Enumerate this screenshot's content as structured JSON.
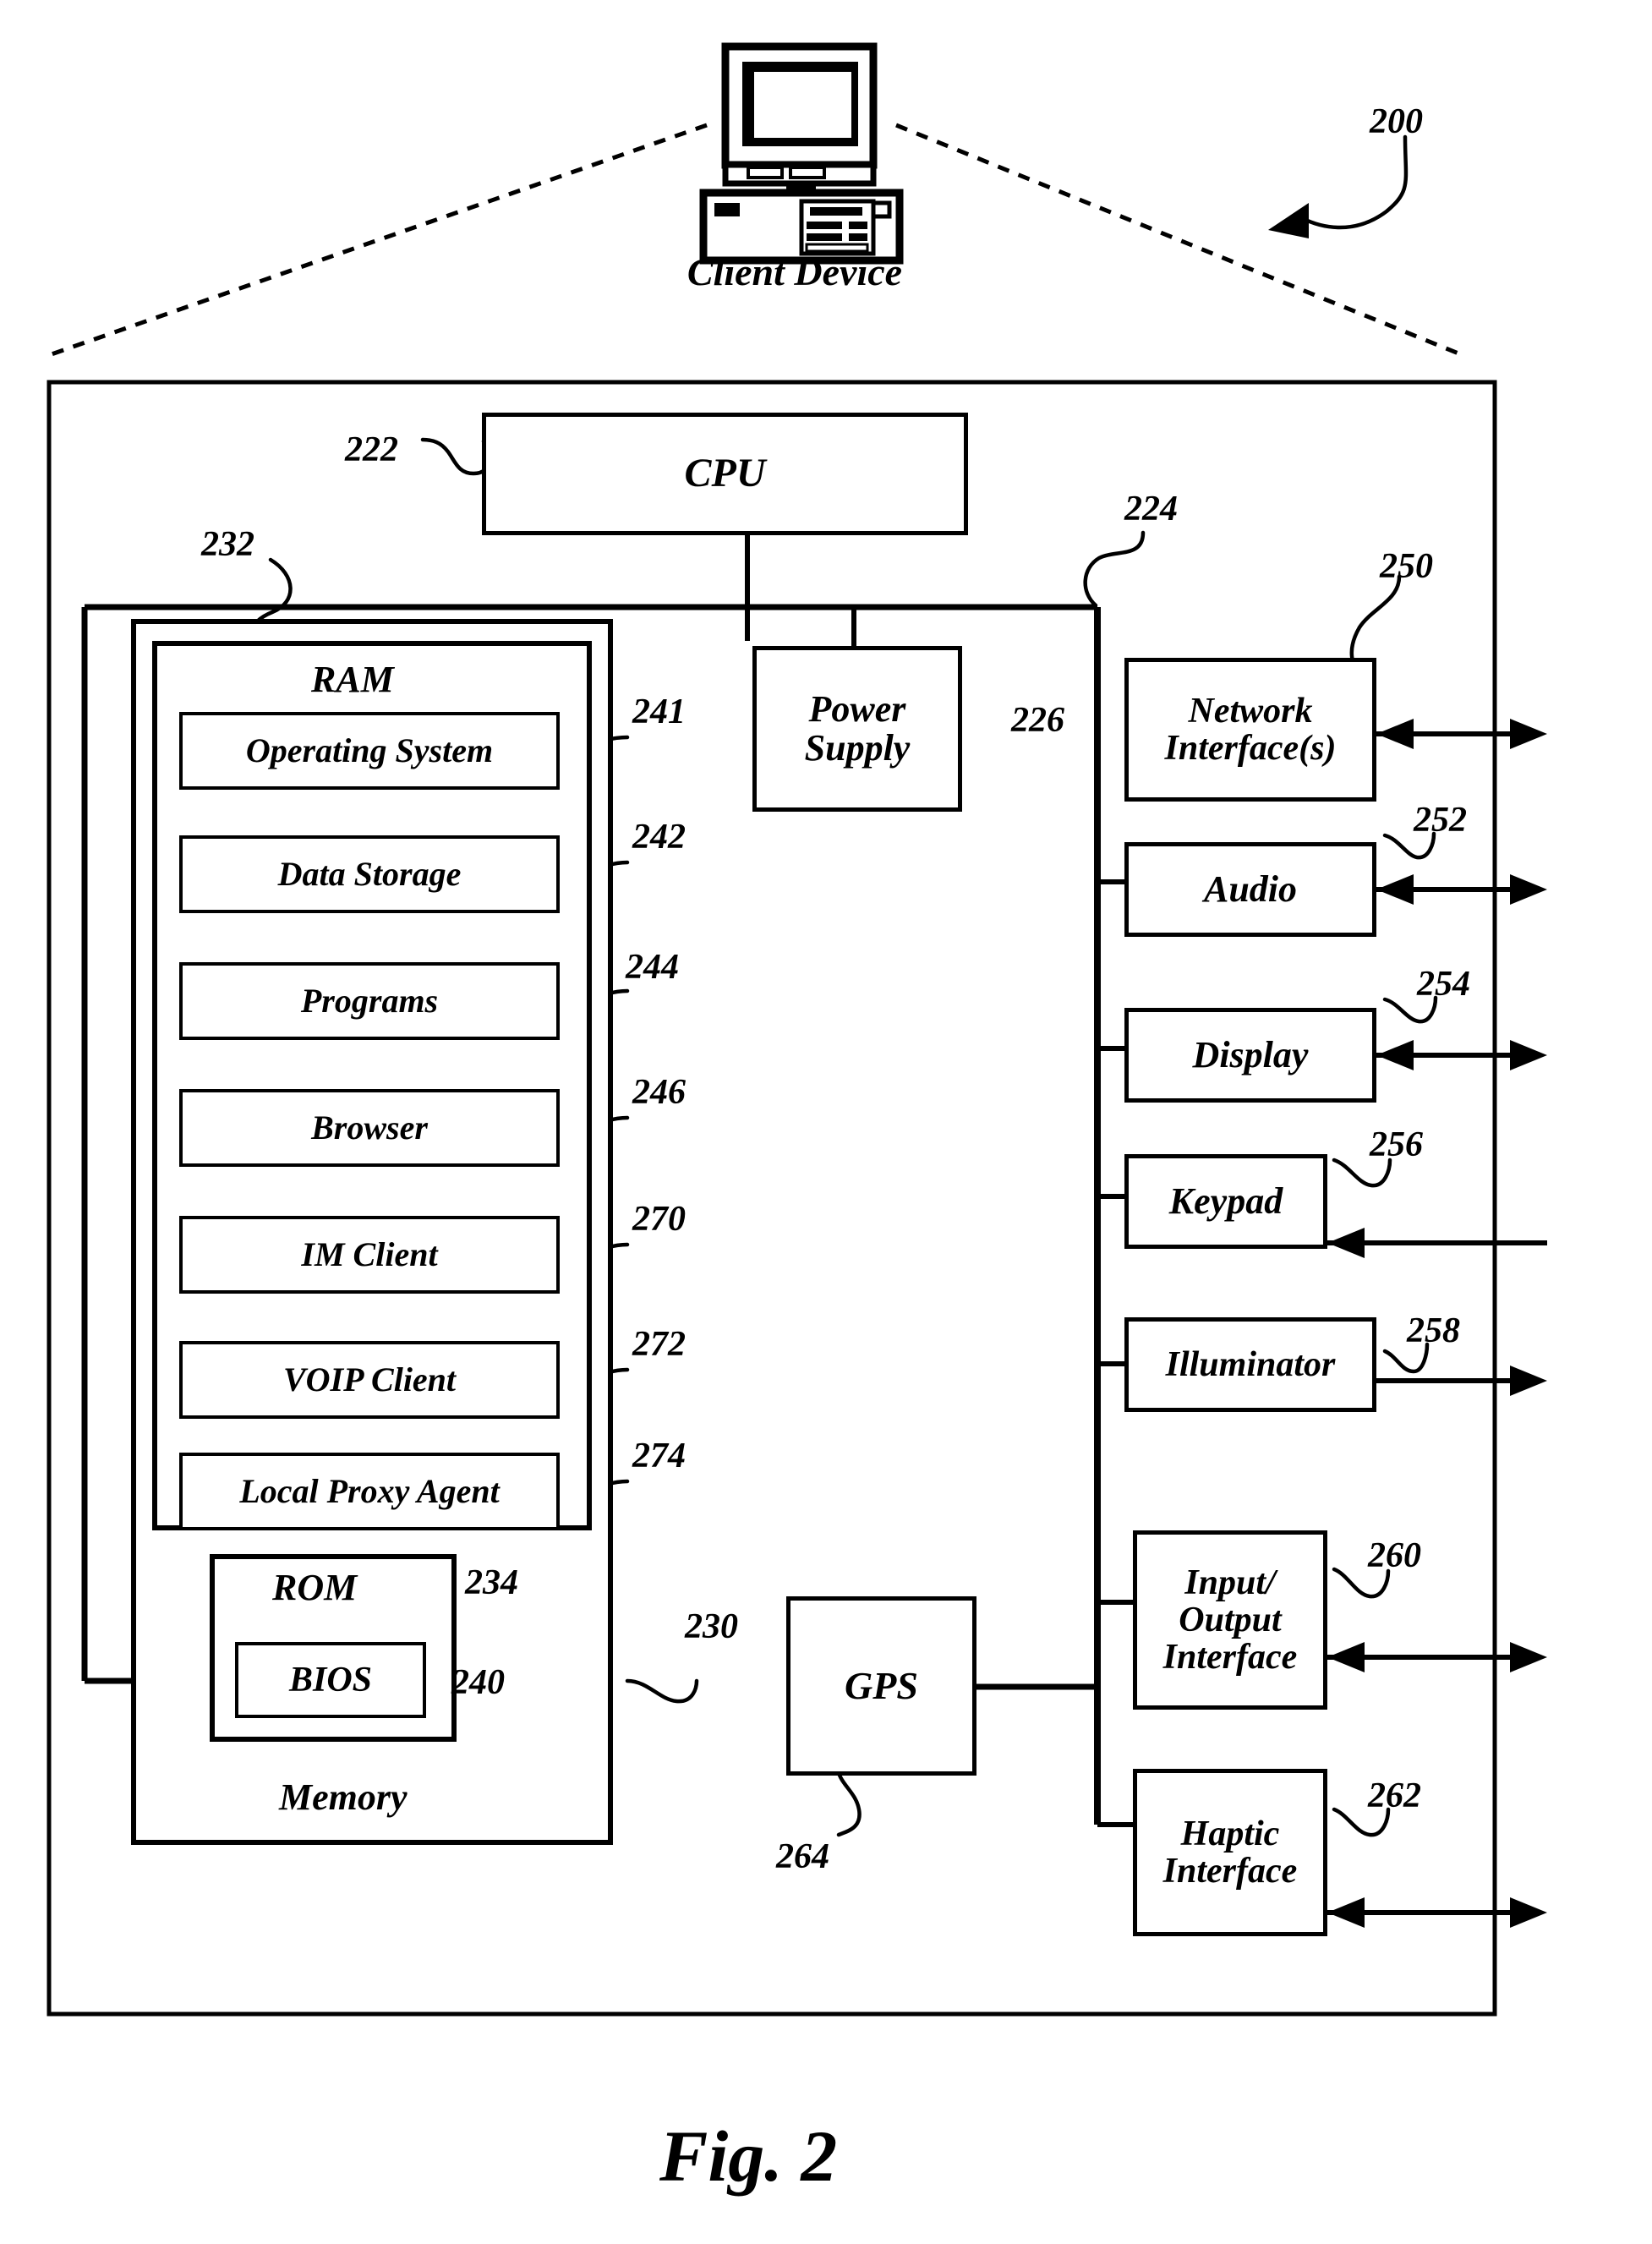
{
  "figure": {
    "caption": "Fig. 2",
    "system_ref": "200",
    "device_label": "Client Device",
    "device_icon": "desktop-computer-icon"
  },
  "blocks": {
    "cpu": {
      "label": "CPU",
      "ref": "222"
    },
    "bus": {
      "ref": "232"
    },
    "memory": {
      "label": "Memory",
      "ref": "230"
    },
    "ram": {
      "label": "RAM"
    },
    "rom": {
      "label": "ROM",
      "ref": "234"
    },
    "bios": {
      "label": "BIOS",
      "ref": "240"
    },
    "power_supply": {
      "label": "Power\nSupply",
      "ref": "226"
    },
    "gps": {
      "label": "GPS",
      "ref": "264"
    },
    "io_bus": {
      "ref": "224"
    }
  },
  "ram_modules": [
    {
      "label": "Operating System",
      "ref": "241"
    },
    {
      "label": "Data Storage",
      "ref": "242"
    },
    {
      "label": "Programs",
      "ref": "244"
    },
    {
      "label": "Browser",
      "ref": "246"
    },
    {
      "label": "IM Client",
      "ref": "270"
    },
    {
      "label": "VOIP  Client",
      "ref": "272"
    },
    {
      "label": "Local Proxy Agent",
      "ref": "274"
    }
  ],
  "peripherals": [
    {
      "label": "Network\nInterface(s)",
      "ref": "250",
      "arrow": "bidirectional"
    },
    {
      "label": "Audio",
      "ref": "252",
      "arrow": "bidirectional"
    },
    {
      "label": "Display",
      "ref": "254",
      "arrow": "bidirectional"
    },
    {
      "label": "Keypad",
      "ref": "256",
      "arrow": "inward"
    },
    {
      "label": "Illuminator",
      "ref": "258",
      "arrow": "outward"
    },
    {
      "label": "Input/\nOutput\nInterface",
      "ref": "260",
      "arrow": "bidirectional"
    },
    {
      "label": "Haptic\nInterface",
      "ref": "262",
      "arrow": "bidirectional"
    }
  ],
  "colors": {
    "ink": "#000000",
    "paper": "#ffffff"
  }
}
